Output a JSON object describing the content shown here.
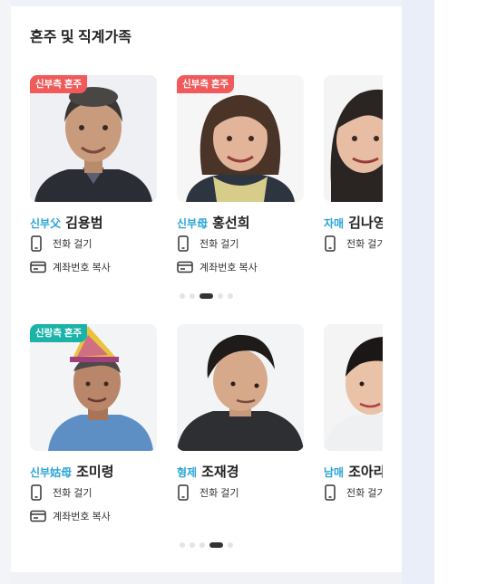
{
  "section_title": "혼주 및 직계가족",
  "bride_row": {
    "people": [
      {
        "badge": "신부측 혼주",
        "relation": "신부父",
        "name": "김용범",
        "call_label": "전화 걸기",
        "account_label": "계좌번호 복사"
      },
      {
        "badge": "신부측 혼주",
        "relation": "신부母",
        "name": "홍선희",
        "call_label": "전화 걸기",
        "account_label": "계좌번호 복사"
      },
      {
        "relation": "자매",
        "name": "김나영",
        "call_label": "전화 걸기"
      }
    ],
    "page_count": 5,
    "active_page": 3
  },
  "groom_row": {
    "people": [
      {
        "badge": "신랑측 혼주",
        "relation": "신부姑母",
        "name": "조미령",
        "call_label": "전화 걸기",
        "account_label": "계좌번호 복사"
      },
      {
        "relation": "형제",
        "name": "조재경",
        "call_label": "전화 걸기"
      },
      {
        "relation": "남매",
        "name": "조아라",
        "call_label": "전화 걸기"
      }
    ],
    "page_count": 5,
    "active_page": 4
  },
  "colors": {
    "bride_badge": "#f05a5a",
    "groom_badge": "#1bb3a8",
    "relation_text": "#2aa4d6",
    "active_dot": "#333333"
  },
  "icons": {
    "call": "phone-icon",
    "account": "card-icon"
  }
}
